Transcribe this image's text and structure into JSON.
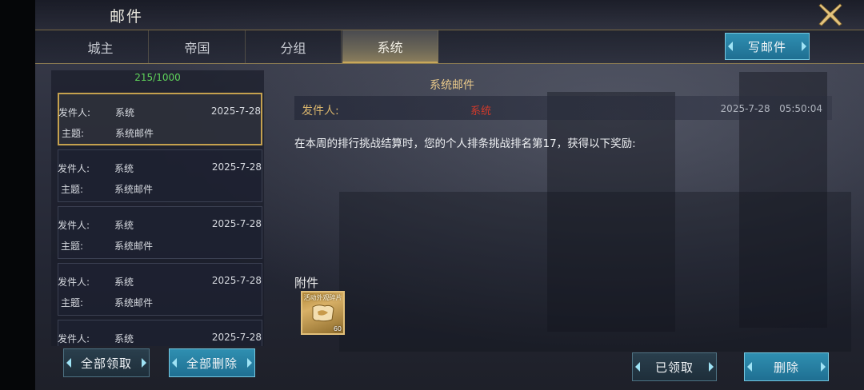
{
  "header": {
    "title": "邮件"
  },
  "tabs": [
    {
      "label": "城主"
    },
    {
      "label": "帝国"
    },
    {
      "label": "分组"
    },
    {
      "label": "系统",
      "active": true
    }
  ],
  "compose_label": "写邮件",
  "mail_list": {
    "count": "215/1000",
    "sender_label": "发件人:",
    "subject_label": "主题:",
    "items": [
      {
        "sender": "系统",
        "date": "2025-7-28",
        "subject": "系统邮件"
      },
      {
        "sender": "系统",
        "date": "2025-7-28",
        "subject": "系统邮件"
      },
      {
        "sender": "系统",
        "date": "2025-7-28",
        "subject": "系统邮件"
      },
      {
        "sender": "系统",
        "date": "2025-7-28",
        "subject": "系统邮件"
      },
      {
        "sender": "系统",
        "date": "2025-7-28",
        "subject": ""
      }
    ],
    "collect_all_label": "全部领取",
    "delete_all_label": "全部删除"
  },
  "mail": {
    "title": "系统邮件",
    "sender_label": "发件人:",
    "sender": "系统",
    "datetime": "2025-7-28   05:50:04",
    "body": "在本周的排行挑战结算时，您的个人排条挑战排名第17，获得以下奖励:",
    "attachments_label": "附件",
    "attachment": {
      "name": "活动外观碎片",
      "quantity": "60"
    },
    "claimed_label": "已领取",
    "delete_label": "删除"
  },
  "colors": {
    "accent_gold": "#c5a14e",
    "button_blue": "#2f8fb1",
    "count_green": "#5fd35a",
    "sender_red": "#d13a2b"
  }
}
